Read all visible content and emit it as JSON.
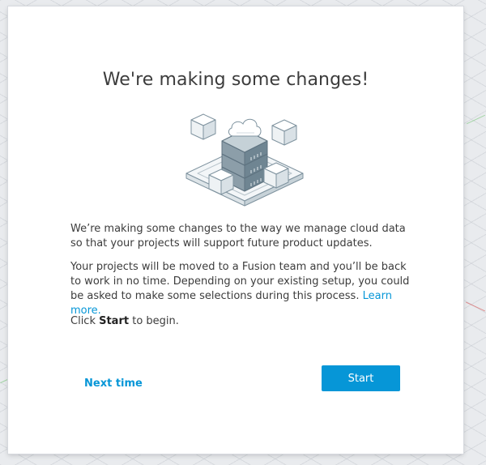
{
  "dialog": {
    "title": "We're making some changes!",
    "paragraph1": "We’re making some changes to the way we manage cloud data so that your projects will support future product updates.",
    "paragraph2_text": "Your projects will be moved to a Fusion team and you’ll be back to work in no time. Depending on your existing setup, you could be asked to make some selections during this process. ",
    "paragraph2_link": "Learn more.",
    "paragraph3_prefix": "Click ",
    "paragraph3_bold": "Start",
    "paragraph3_suffix": " to begin.",
    "next_time_label": "Next time",
    "start_label": "Start",
    "illustration_icon": "cloud-server-stack-icon"
  },
  "colors": {
    "accent": "#0696d7",
    "text": "#3c3c3c",
    "server": "#7f939f",
    "server_light": "#a9b8c1"
  }
}
